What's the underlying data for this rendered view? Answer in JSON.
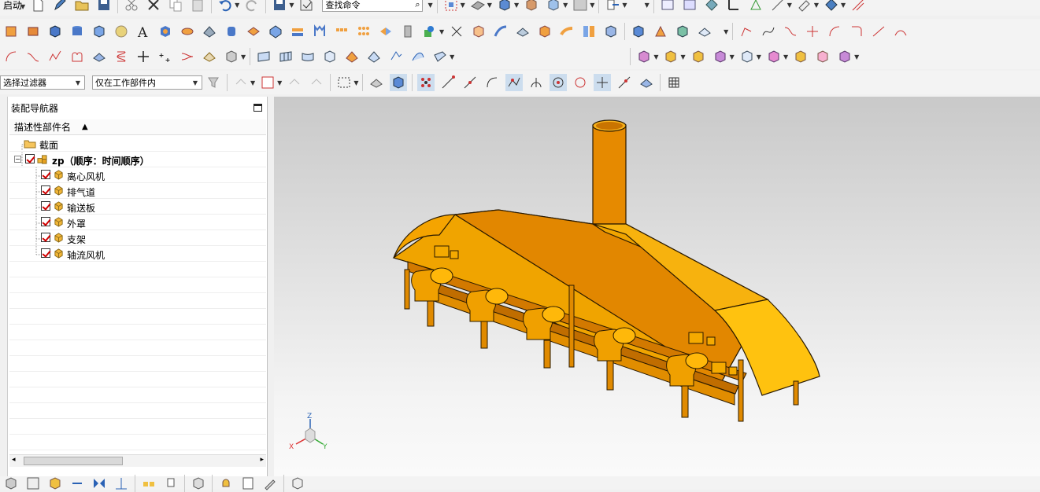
{
  "toolbar": {
    "start_label": "启动",
    "command_search_placeholder": "查找命令",
    "selection_filter": "选择过滤器",
    "scope_filter": "仅在工作部件内"
  },
  "navigator": {
    "title": "装配导航器",
    "column_header": "描述性部件名",
    "items": [
      {
        "label": "截面",
        "level": 0,
        "checked": false,
        "icon": "folder-icon"
      },
      {
        "label": "zp（顺序：时间顺序）",
        "level": 0,
        "checked": true,
        "icon": "assembly-icon",
        "bold": true
      },
      {
        "label": "离心风机",
        "level": 1,
        "checked": true,
        "icon": "part-icon"
      },
      {
        "label": "排气道",
        "level": 1,
        "checked": true,
        "icon": "part-icon"
      },
      {
        "label": "输送板",
        "level": 1,
        "checked": true,
        "icon": "part-icon"
      },
      {
        "label": "外罩",
        "level": 1,
        "checked": true,
        "icon": "part-icon"
      },
      {
        "label": "支架",
        "level": 1,
        "checked": true,
        "icon": "part-icon"
      },
      {
        "label": "轴流风机",
        "level": 1,
        "checked": true,
        "icon": "part-icon"
      }
    ]
  },
  "triad": {
    "x": "X",
    "y": "Y",
    "z": "Z"
  },
  "colors": {
    "model": "#f2a000",
    "model_dark": "#c77a00",
    "model_light": "#ffc21a",
    "accent_check": "#d00000"
  }
}
